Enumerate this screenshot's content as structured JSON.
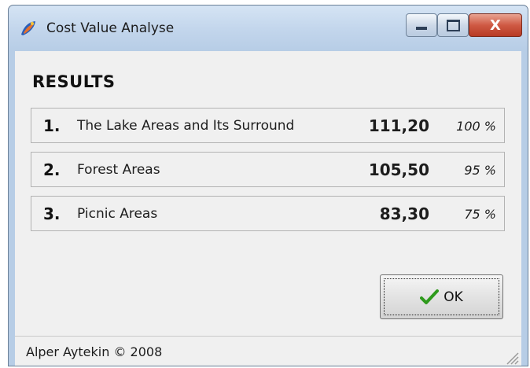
{
  "window": {
    "title": "Cost Value Analyse",
    "close_glyph": "X"
  },
  "results": {
    "heading": "RESULTS",
    "rows": [
      {
        "rank": "1.",
        "label": "The Lake Areas and Its Surround",
        "value": "111,20",
        "percent": "100 %"
      },
      {
        "rank": "2.",
        "label": "Forest Areas",
        "value": "105,50",
        "percent": "95 %"
      },
      {
        "rank": "3.",
        "label": "Picnic Areas",
        "value": "83,30",
        "percent": "75 %"
      }
    ]
  },
  "ok_button": {
    "label": "OK",
    "icon": "checkmark-icon"
  },
  "status": {
    "text": "Alper Aytekin © 2008"
  },
  "colors": {
    "titlebar": "#c3d6ec",
    "client_bg": "#f0f0f0",
    "close_button": "#cf5a44",
    "checkmark": "#2e9a1c"
  }
}
